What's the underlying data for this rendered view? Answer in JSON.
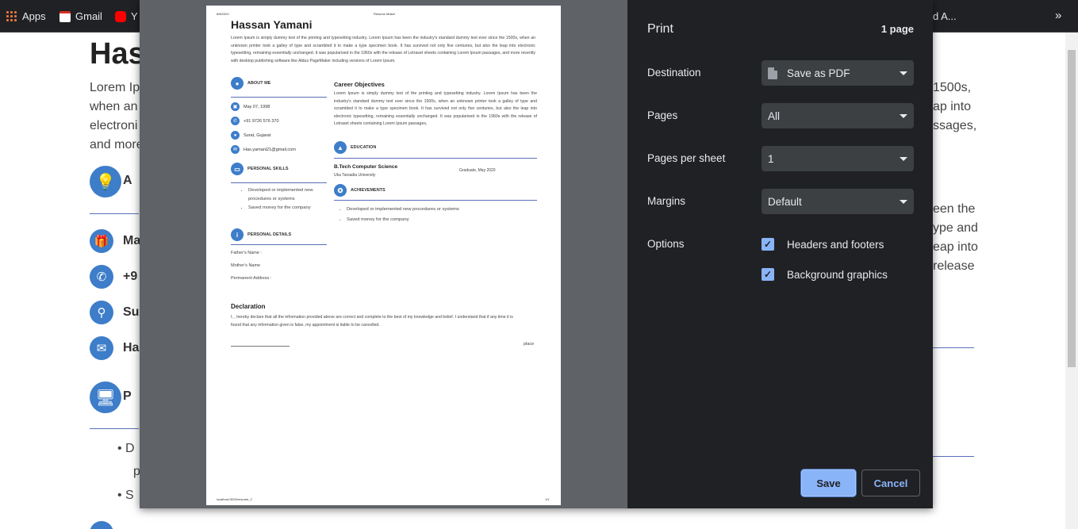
{
  "bookmarks": {
    "apps": "Apps",
    "gmail": "Gmail",
    "youtube": "Y",
    "truncated": "d A...",
    "overflow": "»"
  },
  "background": {
    "title": "Has",
    "para_lines": [
      "Lorem Ip",
      "when an",
      "electroni",
      "and more"
    ],
    "right_lines_top": [
      "1500s,",
      "ap into",
      "ssages,"
    ],
    "right_lines_mid": [
      "een the",
      "ype and",
      "eap into",
      "release"
    ],
    "about": "A",
    "birth": "Ma",
    "phone": "+9",
    "location": "Sur",
    "email": "Ha",
    "skills": "P",
    "bullet1": "D",
    "bullet1b": "p",
    "bullet2": "S"
  },
  "preview": {
    "header_date": "8/8/2020",
    "header_title": "Resume Maker",
    "footer_url": "localhost:3000/resume_2",
    "footer_page": "1/1",
    "name": "Hassan Yamani",
    "summary": "Lorem Ipsum is simply dummy text of the printing and typesetting industry. Lorem Ipsum has been the industry's standard dummy text ever since the 1500s, when an unknown printer took a galley of type and scrambled it to make a type specimen book. It has survived not only five centuries, but also the leap into electronic typesetting, remaining essentially unchanged. It was popularised in the 1960s with the release of Letraset sheets containing Lorem Ipsum passages, and more recently with desktop publishing software like Aldus PageMaker including versions of Lorem Ipsum.",
    "about_me": "ABOUT ME",
    "dob": "May 07, 1998",
    "phone": "+91 9726 576 370",
    "location": "Surat, Gujarat",
    "email": "Has.yamani21@gmail.com",
    "personal_skills": "PERSONAL SKILLS",
    "skills": [
      "Developed or implemented new procedures or systems",
      "Saved money for the company"
    ],
    "personal_details": "PERSONAL DETAILS",
    "father": "Father's Name :",
    "mother": "Mother's Name",
    "address": "Permanent Address :",
    "career_title": "Career Objectives",
    "career_text": "Lorem Ipsum is simply dummy text of the printing and typesetting industry. Lorem Ipsum has been the industry's standard dummy text ever since the 1500s, when an unknown printer took a galley of type and scrambled it to make a type specimen book. It has survived not only five centuries, but also the leap into electronic typesetting, remaining essentially unchanged. It was popularised in the 1960s with the release of Letraset sheets containing Lorem Ipsum passages,",
    "education": "EDUCATION",
    "degree": "B.Tech Computer Science",
    "university": "Uka Tarsadia University",
    "graduation": "Graduate, May 2020",
    "achievements": "ACHIEVEMENTS",
    "achievement_items": [
      "Developed or implemented new procedures or systems",
      "Saved money for the company"
    ],
    "declaration_title": "Declaration",
    "declaration_text": "I, , hereby declare that all the information provided above are correct and complete to the best of my knowledge and belief. I understand that if any time it is found that any information given is false, my appointment is liable to be cancelled.",
    "place": "place"
  },
  "settings": {
    "title": "Print",
    "page_count": "1 page",
    "destination_label": "Destination",
    "destination_value": "Save as PDF",
    "pages_label": "Pages",
    "pages_value": "All",
    "pps_label": "Pages per sheet",
    "pps_value": "1",
    "margins_label": "Margins",
    "margins_value": "Default",
    "options_label": "Options",
    "opt_headers": "Headers and footers",
    "opt_background": "Background graphics",
    "save": "Save",
    "cancel": "Cancel"
  },
  "colors": {
    "accent": "#8ab4f8",
    "panel": "#202124",
    "resume_blue": "#3d7dc9"
  }
}
